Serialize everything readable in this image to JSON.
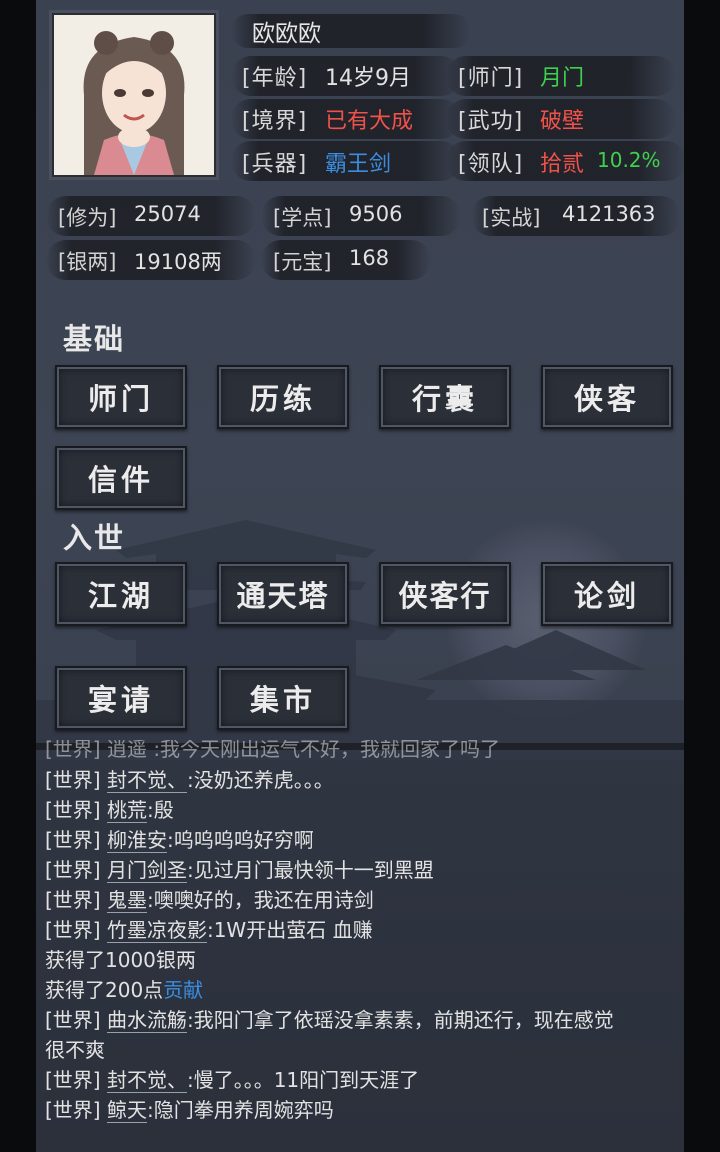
{
  "profile": {
    "name": "欧欧欧",
    "age_label": "[年龄]",
    "age": "14岁9月",
    "realm_label": "[境界]",
    "realm": "已有大成",
    "weapon_label": "[兵器]",
    "weapon": "霸王剑",
    "sect_label": "[师门]",
    "sect": "月门",
    "martial_label": "[武功]",
    "martial": "破壁",
    "team_label": "[领队]",
    "team": "拾贰",
    "team_pct": "10.2%"
  },
  "resources": {
    "cultivation_label": "[修为]",
    "cultivation": "25074",
    "study_label": "[学点]",
    "study": "9506",
    "combat_label": "[实战]",
    "combat": "4121363",
    "silver_label": "[银两]",
    "silver": "19108两",
    "ingot_label": "[元宝]",
    "ingot": "168"
  },
  "sections": {
    "basic": "基础",
    "world": "入世"
  },
  "basic_buttons": [
    "师门",
    "历练",
    "行囊",
    "侠客",
    "信件"
  ],
  "world_buttons": [
    "江湖",
    "通天塔",
    "侠客行",
    "论剑",
    "宴请",
    "集市"
  ],
  "chat": {
    "partial": "[世界] 逍遥 :我今天刚出运气不好，我就回家了吗了",
    "lines": [
      {
        "tag": "[世界]",
        "user": "封不觉、",
        "msg": ":没奶还养虎。。。"
      },
      {
        "tag": "[世界]",
        "user": "桃荒",
        "msg": ":殷"
      },
      {
        "tag": "[世界]",
        "user": "柳淮安",
        "msg": ":呜呜呜呜好穷啊"
      },
      {
        "tag": "[世界]",
        "user": "月门剑圣",
        "msg": ":见过月门最快领十一到黑盟"
      },
      {
        "tag": "[世界]",
        "user": "鬼墨",
        "msg": ":噢噢好的，我还在用诗剑"
      },
      {
        "tag": "[世界]",
        "user": "竹墨凉夜影",
        "msg": ":1W开出萤石 血赚"
      }
    ],
    "gain_silver": "获得了1000银两",
    "gain_contrib_prefix": "获得了200点",
    "gain_contrib_link": "贡献",
    "line_long_tag": "[世界]",
    "line_long_user": "曲水流觞",
    "line_long_msg": ":我阳门拿了依瑶没拿素素，前期还行，现在感觉",
    "line_long_cont": "很不爽",
    "line_a": {
      "tag": "[世界]",
      "user": "封不觉、",
      "msg": ":慢了。。。11阳门到天涯了"
    },
    "line_b": {
      "tag": "[世界]",
      "user": "鲸天",
      "msg": ":隐门拳用养周婉弈吗"
    }
  },
  "colors": {
    "green": "#3fd04e",
    "red": "#f0524a",
    "blue": "#3b8de0"
  }
}
